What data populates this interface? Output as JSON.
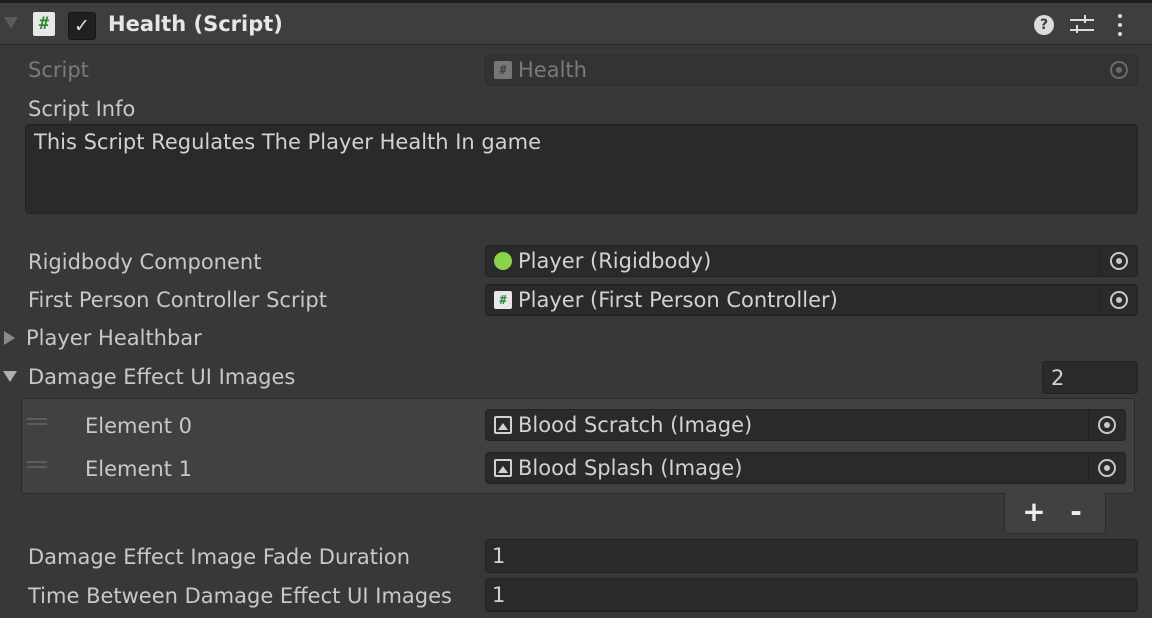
{
  "component": {
    "title": "Health (Script)",
    "enabled_check": "✓",
    "script_glyph": "#",
    "help_glyph": "?"
  },
  "fields": {
    "script": {
      "label": "Script",
      "value": "Health"
    },
    "script_info": {
      "label": "Script Info",
      "value": "This Script Regulates The Player Health In game"
    },
    "rigidbody": {
      "label": "Rigidbody Component",
      "value": "Player (Rigidbody)"
    },
    "fps_controller": {
      "label": "First Person Controller Script",
      "value": "Player (First Person Controller)"
    },
    "player_healthbar": {
      "label": "Player Healthbar",
      "expanded": false
    },
    "damage_images": {
      "label": "Damage Effect UI Images",
      "count": "2",
      "expanded": true,
      "elements": [
        {
          "label": "Element 0",
          "value": "Blood Scratch (Image)"
        },
        {
          "label": "Element 1",
          "value": "Blood Splash (Image)"
        }
      ],
      "add_label": "+",
      "remove_label": "-"
    },
    "fade_duration": {
      "label": "Damage Effect Image Fade Duration",
      "value": "1"
    },
    "time_between": {
      "label": "Time Between Damage Effect UI Images",
      "value": "1"
    }
  },
  "icons": {
    "fold": "chevron-down-icon",
    "script": "script-icon",
    "help": "help-icon",
    "presets": "presets-icon",
    "menu": "kebab-menu-icon",
    "object_picker": "object-picker-icon",
    "rigidbody": "rigidbody-icon",
    "image": "image-icon"
  },
  "colors": {
    "background": "#383838",
    "header": "#3e3e3e",
    "field": "#2a2a2a",
    "rigidbody_icon": "#8ad34a",
    "script_icon_mark": "#2f8a3a"
  }
}
